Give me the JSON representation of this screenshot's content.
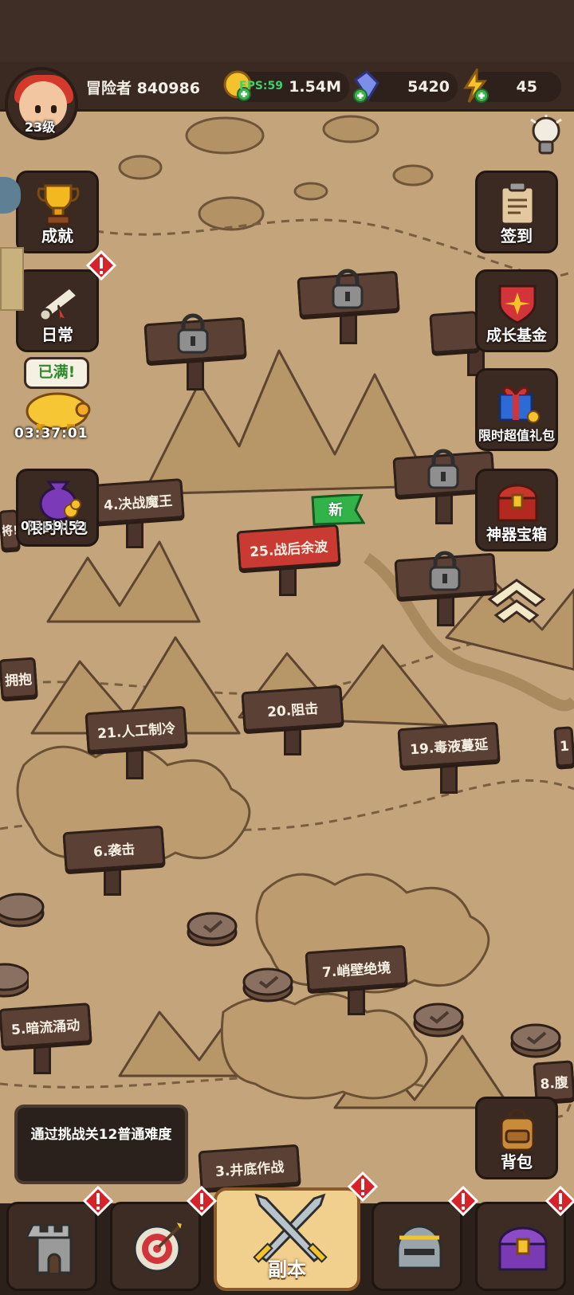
{
  "header": {
    "player_name": "冒险者 840986",
    "level": "23级",
    "fps": "FPS:59",
    "coins": "1.54M",
    "gems": "5420",
    "energy": "45"
  },
  "left_buttons": [
    {
      "label": "成就",
      "icon": "trophy-icon"
    },
    {
      "label": "日常",
      "icon": "scroll-icon"
    }
  ],
  "piggy": {
    "bubble": "已满!",
    "timer": "03:37:01"
  },
  "limited_pack": {
    "label": "限时礼包",
    "timer": "01:59:52"
  },
  "right_buttons": [
    {
      "label": "签到",
      "icon": "clipboard-icon"
    },
    {
      "label": "成长基金",
      "icon": "shield-badge-icon"
    },
    {
      "label": "限时超值礼包",
      "icon": "gift-box-icon"
    },
    {
      "label": "神器宝箱",
      "icon": "treasure-chest-icon"
    },
    {
      "label": "背包",
      "icon": "backpack-icon"
    }
  ],
  "stages": {
    "s24": "4.决战魔王",
    "s25": "25.战后余波",
    "s_hug": "拥抱",
    "s_left_edge": "将!",
    "s21": "21.人工制冷",
    "s20": "20.阻击",
    "s19": "19.毒液蔓延",
    "s6": "6.袭击",
    "s7": "7.峭壁绝境",
    "s5": "5.暗流涌动",
    "s3": "3.井底作战",
    "s8": "8.腹",
    "s_right_edge": "1"
  },
  "new_badge": "新",
  "quest_text": "通过挑战关12普通难度",
  "bottom_nav": {
    "active_label": "副本",
    "tabs": [
      "tower-icon",
      "target-icon",
      "crossed-swords-icon",
      "helmet-icon",
      "chest-icon"
    ]
  },
  "colors": {
    "map": "#c2a278",
    "panel": "#3a2a22",
    "alert": "#d8222a",
    "new_green": "#31b34a",
    "active_tab": "#f1cf8d"
  }
}
